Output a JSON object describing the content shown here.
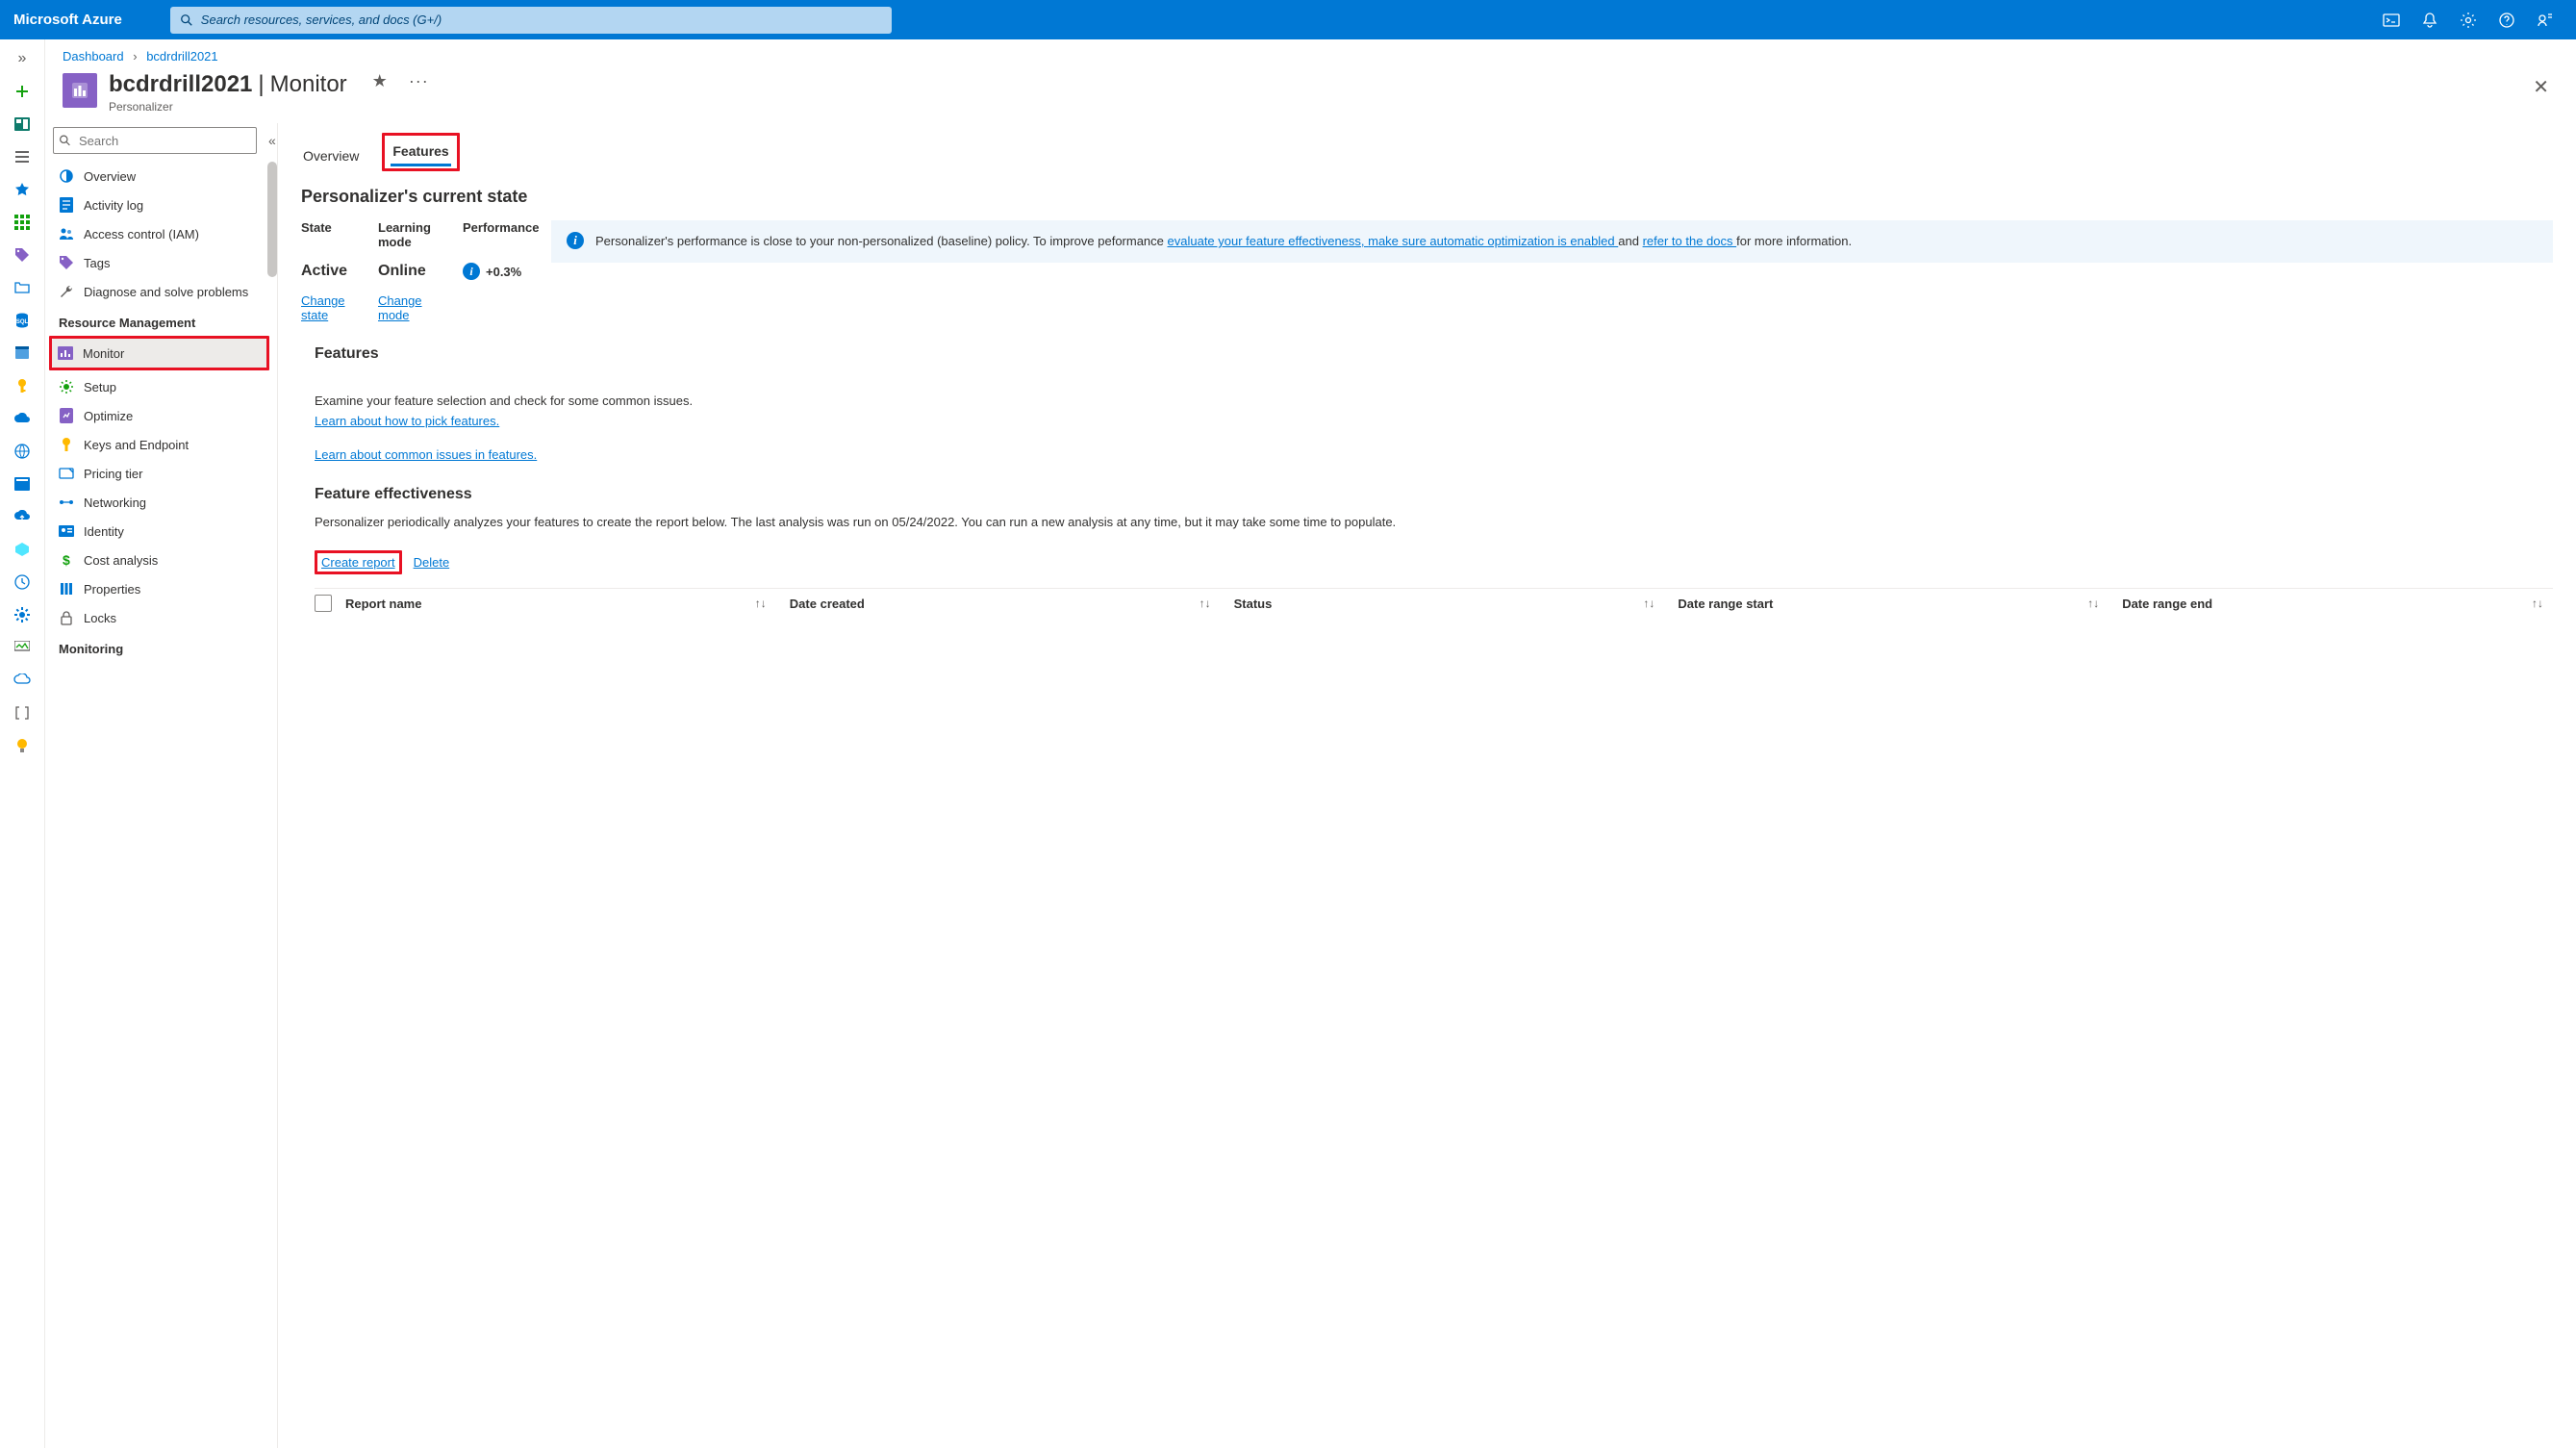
{
  "topbar": {
    "brand": "Microsoft Azure",
    "search_placeholder": "Search resources, services, and docs (G+/)"
  },
  "breadcrumb": {
    "items": [
      "Dashboard",
      "bcdrdrill2021"
    ]
  },
  "page": {
    "title_resource": "bcdrdrill2021",
    "title_section": "Monitor",
    "subtype": "Personalizer"
  },
  "resmenu": {
    "search_placeholder": "Search",
    "top_items": [
      {
        "label": "Overview"
      },
      {
        "label": "Activity log"
      },
      {
        "label": "Access control (IAM)"
      },
      {
        "label": "Tags"
      },
      {
        "label": "Diagnose and solve problems"
      }
    ],
    "group1": "Resource Management",
    "group1_items": [
      {
        "label": "Monitor",
        "active": true
      },
      {
        "label": "Setup"
      },
      {
        "label": "Optimize"
      },
      {
        "label": "Keys and Endpoint"
      },
      {
        "label": "Pricing tier"
      },
      {
        "label": "Networking"
      },
      {
        "label": "Identity"
      },
      {
        "label": "Cost analysis"
      },
      {
        "label": "Properties"
      },
      {
        "label": "Locks"
      }
    ],
    "group2": "Monitoring"
  },
  "tabs": {
    "overview": "Overview",
    "features": "Features"
  },
  "state": {
    "heading": "Personalizer's current state",
    "hdr_state": "State",
    "hdr_mode": "Learning mode",
    "hdr_perf": "Performance",
    "val_state": "Active",
    "val_mode": "Online",
    "val_perf": "+0.3%",
    "change_state": "Change state",
    "change_mode": "Change mode"
  },
  "banner": {
    "text1": "Personalizer's performance is close to your non-personalized (baseline) policy. To improve peformance ",
    "link1": "evaluate your feature effectiveness, ",
    "link2": "make sure automatic optimization is enabled ",
    "mid": " and ",
    "link3": "refer to the docs ",
    "text2": " for more information."
  },
  "features": {
    "heading": "Features",
    "desc": "Examine your feature selection and check for some common issues.",
    "link1": "Learn about how to pick features.",
    "link2": "Learn about common issues in features."
  },
  "effectiveness": {
    "heading": "Feature effectiveness",
    "desc": "Personalizer periodically analyzes your features to create the report below. The last analysis was run on 05/24/2022. You can run a new analysis at any time, but it may take some time to populate.",
    "create": "Create report",
    "delete": "Delete"
  },
  "table": {
    "cols": [
      "Report name",
      "Date created",
      "Status",
      "Date range start",
      "Date range end"
    ]
  }
}
